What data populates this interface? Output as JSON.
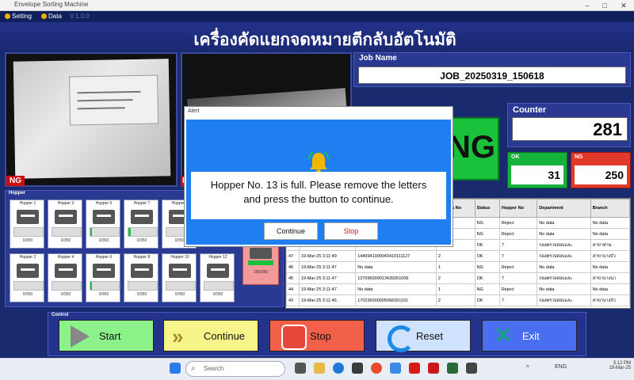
{
  "window": {
    "title": "Envelope Sorting Machine"
  },
  "menu": {
    "setting": "Setting",
    "data": "Data",
    "version": "V.1.0.0"
  },
  "header": {
    "title": "เครื่องคัดแยกจดหมายตีกลับอัตโนมัติ"
  },
  "camera": {
    "left_tag": "NG",
    "right_tag": "NG"
  },
  "job": {
    "label": "Job Name",
    "value": "JOB_20250319_150618"
  },
  "result": {
    "value": "NG",
    "color": "#19c23a"
  },
  "counter": {
    "label": "Counter",
    "total": "281",
    "ok_label": "OK",
    "ok": "31",
    "ng_label": "NG",
    "ng": "250"
  },
  "hoppers": {
    "label": "Hopper",
    "items": [
      {
        "name": "Hopper 1",
        "count": "0/350",
        "fill": 0
      },
      {
        "name": "Hopper 3",
        "count": "0/350",
        "fill": 0
      },
      {
        "name": "Hopper 5",
        "count": "0/350",
        "fill": 0.05
      },
      {
        "name": "Hopper 7",
        "count": "0/350",
        "fill": 0.08
      },
      {
        "name": "Hopper 9",
        "count": "0/350",
        "fill": 0
      },
      {
        "name": "Hopper 2",
        "count": "0/350",
        "fill": 0
      },
      {
        "name": "Hopper 4",
        "count": "0/350",
        "fill": 0
      },
      {
        "name": "Hopper 6",
        "count": "0/350",
        "fill": 0.05
      },
      {
        "name": "Hopper 8",
        "count": "0/350",
        "fill": 0
      },
      {
        "name": "Hopper 10",
        "count": "0/350",
        "fill": 0
      },
      {
        "name": "Hopper 12",
        "count": "0/350",
        "fill": 0
      }
    ],
    "reject": {
      "count": "250/350"
    }
  },
  "table": {
    "headers": [
      "",
      "Date",
      "Barcode",
      "Camera No",
      "Status",
      "Hopper No",
      "Department",
      "Branch"
    ],
    "rows": [
      [
        "",
        "",
        "",
        "2",
        "NG",
        "Reject",
        "No data",
        "No data"
      ],
      [
        "",
        "",
        "",
        "1",
        "NG",
        "Reject",
        "No data",
        "No data"
      ],
      [
        "",
        "",
        "",
        "2",
        "OK",
        "7",
        "กองตรวจสอบและ",
        "สาขาท่าน"
      ],
      [
        "47",
        "19-Mar-25 3:11:49",
        "1440941000043410111127",
        "2",
        "OK",
        "7",
        "กองตรวจสอบและ",
        "สาขาบางบัว"
      ],
      [
        "46",
        "19-Mar-25 3:11:47",
        "No data",
        "1",
        "NG",
        "Reject",
        "No data",
        "No data"
      ],
      [
        "45",
        "19-Mar-25 3:11:47",
        "137096000013439261006",
        "2",
        "OK",
        "7",
        "กองตรวจสอบและ",
        "สาขาบางนา"
      ],
      [
        "44",
        "19-Mar-25 3:11:47",
        "No data",
        "1",
        "NG",
        "Reject",
        "No data",
        "No data"
      ],
      [
        "43",
        "19-Mar-25 3:11:46",
        "170236000005068261101",
        "2",
        "OK",
        "7",
        "กองตรวจสอบและ",
        "สาขาบางบัว"
      ]
    ]
  },
  "control": {
    "label": "Control",
    "start": "Start",
    "continue": "Continue",
    "stop": "Stop",
    "reset": "Reset",
    "exit": "Exit"
  },
  "dialog": {
    "title": "Alert",
    "message": "Hopper No. 13  is full. Please remove the letters and press the button to continue.",
    "continue": "Continue",
    "stop": "Stop"
  },
  "taskbar": {
    "search_placeholder": "Search",
    "lang": "ENG",
    "time": "3:12 PM",
    "date": "19-Mar-25"
  }
}
